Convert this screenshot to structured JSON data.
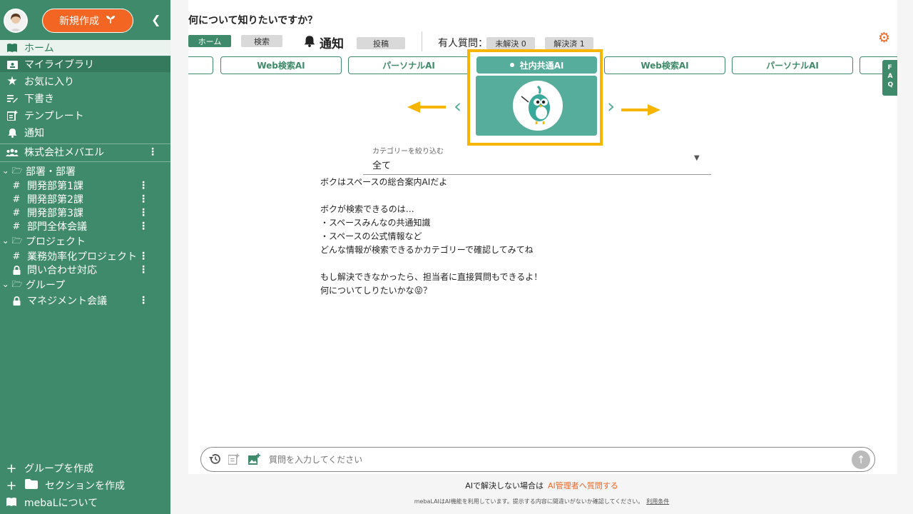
{
  "sidebar": {
    "new_button": "新規作成",
    "nav": [
      {
        "label": "ホーム",
        "icon": "book-icon"
      },
      {
        "label": "マイライブラリ",
        "icon": "library-icon"
      },
      {
        "label": "お気に入り",
        "icon": "star-icon"
      },
      {
        "label": "下書き",
        "icon": "draft-icon"
      },
      {
        "label": "テンプレート",
        "icon": "template-icon"
      },
      {
        "label": "通知",
        "icon": "bell-icon"
      }
    ],
    "org": "株式会社メバエル",
    "sections": [
      {
        "label": "部署・部署",
        "items": [
          "開発部第1課",
          "開発部第2課",
          "開発部第3課",
          "部門全体会議"
        ]
      },
      {
        "label": "プロジェクト",
        "items": [
          "業務効率化プロジェクト",
          "問い合わせ対応"
        ]
      },
      {
        "label": "グループ",
        "items": [
          "マネジメント会議"
        ]
      }
    ],
    "bottom": [
      "グループを作成",
      "セクションを作成",
      "mebaLについて"
    ]
  },
  "header": {
    "title": "何について知りたいですか？",
    "home_pill": "ホーム",
    "search_pill": "検索",
    "notify": "通知",
    "post_pill": "投稿",
    "question_label": "有人質問：",
    "unresolved": "未解決 0",
    "resolved": "解決済 1"
  },
  "tabs": [
    "Web検索AI",
    "パーソナルAI",
    "社内共通AI",
    "Web検索AI",
    "パーソナルAI"
  ],
  "faq": "FAQ",
  "category": {
    "label": "カテゴリーを絞り込む",
    "value": "全て"
  },
  "message": {
    "l1": "ボクはスペースの総合案内AIだよ",
    "l2": "ボクが検索できるのは…",
    "l3": "・スペースみんなの共通知識",
    "l4": "・スペースの公式情報など",
    "l5": "どんな情報が検索できるかカテゴリーで確認してみてね",
    "l6": "もし解決できなかったら、担当者に直接質問もできるよ！",
    "l7": "何についてしりたいかな😝？"
  },
  "input": {
    "placeholder": "質問を入力してください"
  },
  "footer": {
    "line1": "AIで解決しない場合は",
    "line1_link": "AI管理者へ質問する",
    "line2": "mebaLAIはAI機能を利用しています。提示する内容に間違いがないか確認してください。",
    "line2_link": "利用条件"
  },
  "colors": {
    "primary": "#3f8a6a",
    "accent": "#f26522",
    "highlight": "#f7b500",
    "card": "#57ad9b"
  }
}
